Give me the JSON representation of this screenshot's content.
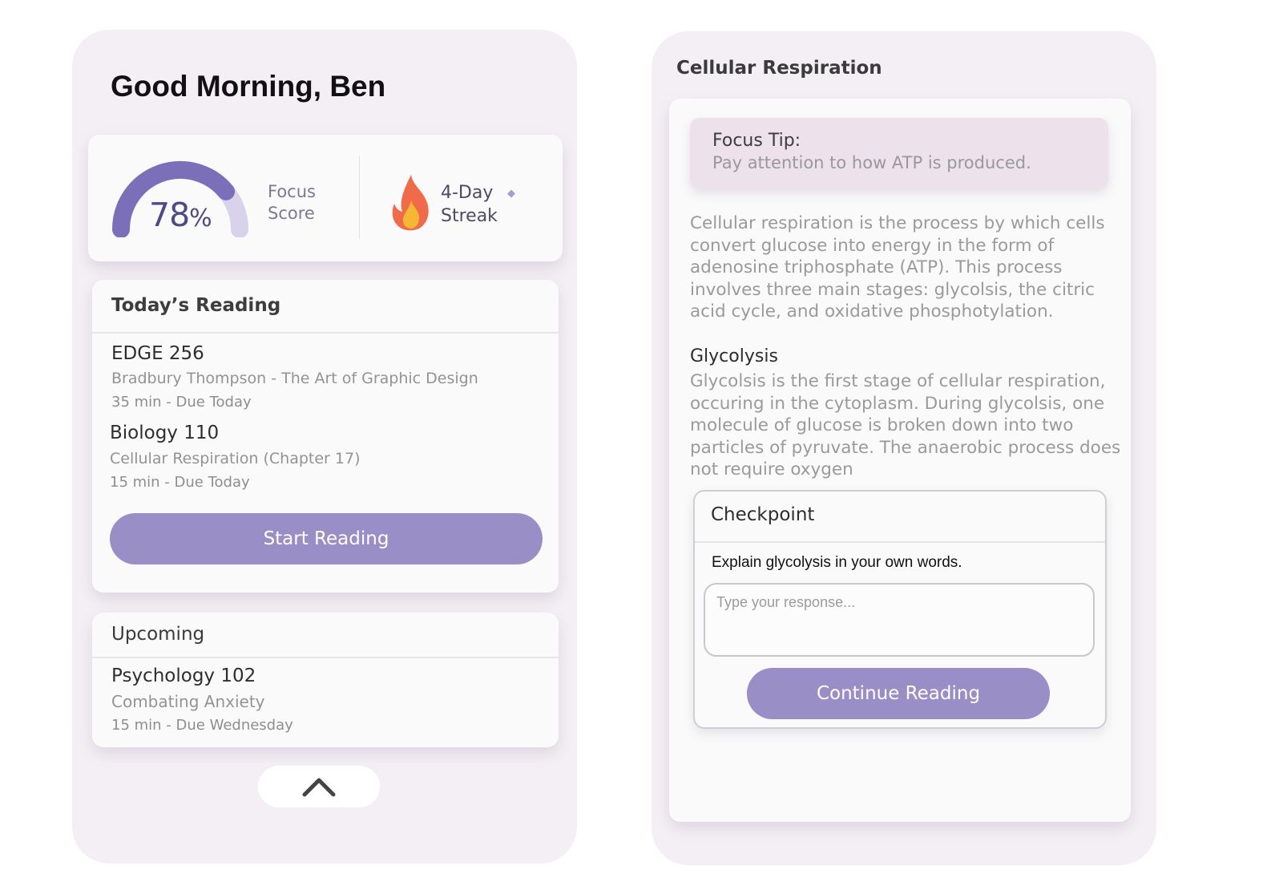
{
  "greeting": "Good Morning, Ben",
  "stats": {
    "focus_score_value": "78",
    "focus_score_unit": "%",
    "focus_score_fraction": 0.78,
    "focus_label_line1": "Focus",
    "focus_label_line2": "Score",
    "streak_label_line1": "4-Day",
    "streak_label_line2": "Streak",
    "streak_icon": "flame-icon"
  },
  "todays_reading": {
    "title": "Today’s Reading",
    "items": [
      {
        "course": "EDGE 256",
        "reading": "Bradbury Thompson - The Art of Graphic Design",
        "meta": "35 min - Due Today"
      },
      {
        "course": "Biology 110",
        "reading": "Cellular Respiration (Chapter 17)",
        "meta": "15 min - Due Today"
      }
    ],
    "button_label": "Start Reading"
  },
  "upcoming": {
    "title": "Upcoming",
    "items": [
      {
        "course": "Psychology 102",
        "reading": "Combating Anxiety",
        "meta": "15 min - Due Wednesday"
      }
    ]
  },
  "collapse_icon": "chevron-up-icon",
  "reader": {
    "title": "Cellular Respiration",
    "tip_title": "Focus Tip:",
    "tip_text": "Pay attention to how ATP is produced.",
    "intro": "Cellular respiration is the process by which cells convert glucose into energy in the form of adenosine triphosphate (ATP). This process involves three main stages: glycolsis, the citric acid cycle, and oxidative phosphotylation.",
    "section_heading": "Glycolysis",
    "section_text": "Glycolsis is the first stage of cellular respiration, occuring in the cytoplasm. During glycolsis, one molecule of glucose is broken down into two particles of pyruvate. The anaerobic process does not require oxygen",
    "checkpoint": {
      "title": "Checkpoint",
      "question": "Explain glycolysis in your own words.",
      "placeholder": "Type your response...",
      "button_label": "Continue Reading"
    }
  },
  "colors": {
    "accent": "#9a8ec6",
    "phone_bg": "#f4eff5",
    "tip_bg": "#ede1ec",
    "gauge_fill": "#7b6fba",
    "gauge_track": "#d8d2ea",
    "flame_outer": "#ef6b4a",
    "flame_inner": "#f7b733"
  }
}
